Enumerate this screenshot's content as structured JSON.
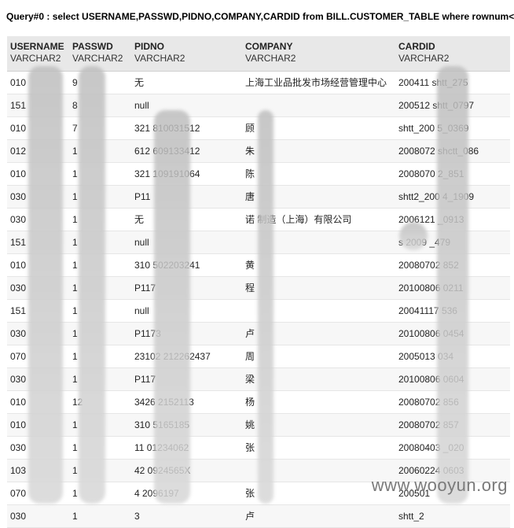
{
  "query": "Query#0 : select USERNAME,PASSWD,PIDNO,COMPANY,CARDID from BILL.CUSTOMER_TABLE where rownum<=20",
  "columns": [
    {
      "name": "USERNAME",
      "type": "VARCHAR2"
    },
    {
      "name": "PASSWD",
      "type": "VARCHAR2"
    },
    {
      "name": "PIDNO",
      "type": "VARCHAR2"
    },
    {
      "name": "COMPANY",
      "type": "VARCHAR2"
    },
    {
      "name": "CARDID",
      "type": "VARCHAR2"
    }
  ],
  "rows": [
    [
      "010",
      "9",
      "无",
      "上海工业品批发市场经营管理中心",
      "200411     shtt_275"
    ],
    [
      "151",
      "8",
      "null",
      "",
      "200512     shtt_0797"
    ],
    [
      "010",
      "7",
      "321          810031512",
      "顾",
      "shtt_200      5_0369"
    ],
    [
      "012",
      "1",
      "612          609133412",
      "朱",
      "2008072      shctt_086"
    ],
    [
      "010",
      "1",
      "321          109191064",
      "陈",
      "2008070      2_851"
    ],
    [
      "030",
      "1",
      "P11",
      "唐",
      "shtt2_200      4_1909"
    ],
    [
      "030",
      "1",
      "无",
      "诺        制造（上海）有限公司",
      "2006121      _0913"
    ],
    [
      "151",
      "1",
      "null",
      "",
      "s        2009      _479"
    ],
    [
      "010",
      "1",
      "310          502203241",
      "黄",
      "20080702      852"
    ],
    [
      "030",
      "1",
      "P117",
      "程",
      "20100806      0211"
    ],
    [
      "151",
      "1",
      "null",
      "",
      "20041117      536"
    ],
    [
      "030",
      "1",
      "P1173",
      "卢",
      "20100806      0454"
    ],
    [
      "070",
      "1",
      "23102          212262437",
      "周",
      "2005013      034"
    ],
    [
      "030",
      "1",
      "P117",
      "梁",
      "20100806      0604"
    ],
    [
      "010",
      "12",
      "3426          2152113",
      "杨",
      "20080702      856"
    ],
    [
      "010",
      "1",
      "310          5165185",
      "姚",
      "20080702      857"
    ],
    [
      "030",
      "1",
      "11          01234062",
      "张",
      "20080403      _020"
    ],
    [
      "103",
      "1",
      "42          0924565X",
      "",
      "20060224      0603"
    ],
    [
      "070",
      "1",
      "4          2096197",
      "张",
      "200501      "
    ],
    [
      "030",
      "1",
      "3          ",
      "卢",
      "shtt_2      "
    ]
  ],
  "watermark": "www.wooyun.org"
}
